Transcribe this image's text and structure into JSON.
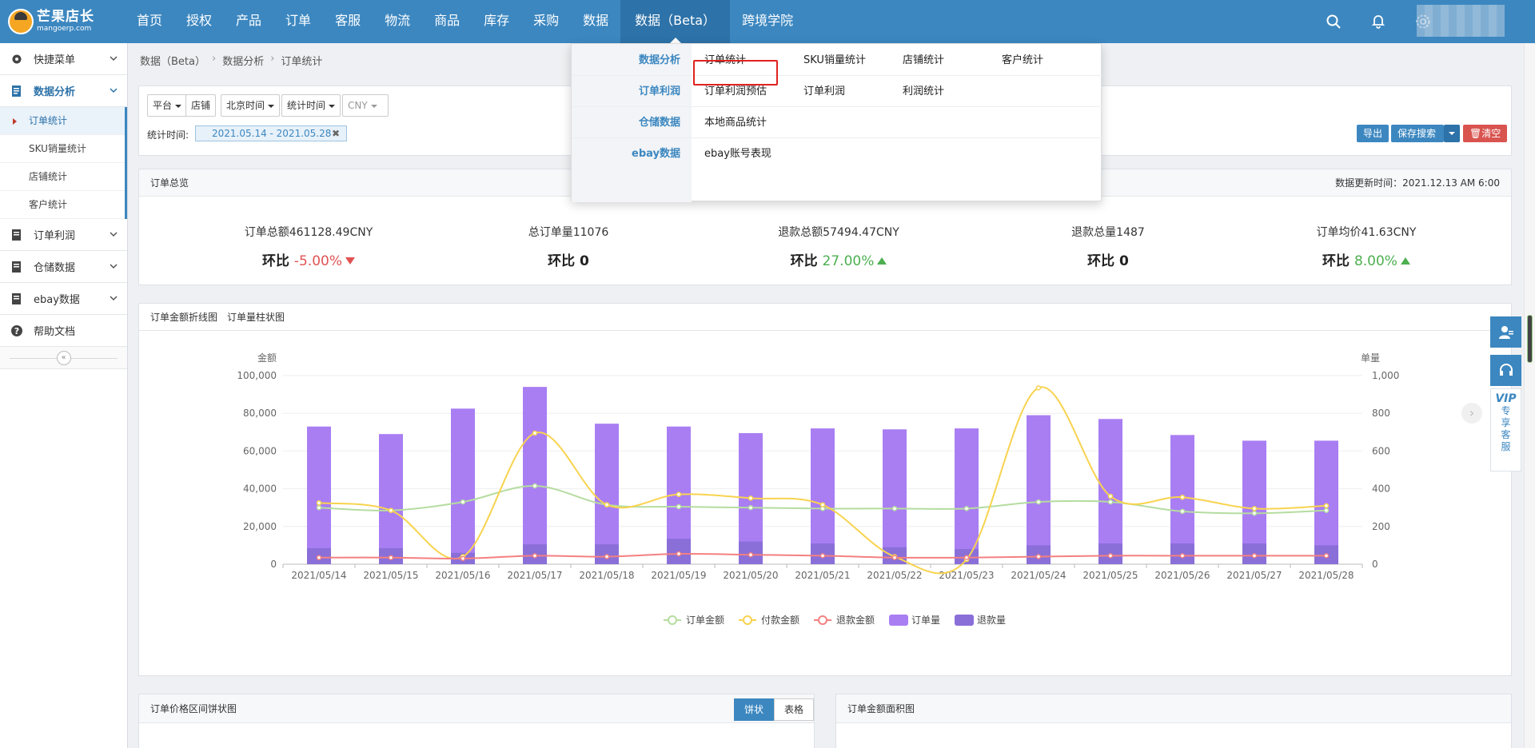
{
  "header": {
    "logo_title": "芒果店长",
    "logo_sub": "mangoerp.com",
    "nav": [
      "首页",
      "授权",
      "产品",
      "订单",
      "客服",
      "物流",
      "商品",
      "库存",
      "采购",
      "数据",
      "数据（Beta）",
      "跨境学院"
    ],
    "active_nav": "数据（Beta）",
    "icons": [
      "search-icon",
      "bell-icon",
      "gear-icon"
    ]
  },
  "sidebar": {
    "quick_menu": "快捷菜单",
    "groups": [
      {
        "label": "数据分析",
        "open": true,
        "items": [
          "订单统计",
          "SKU销量统计",
          "店铺统计",
          "客户统计"
        ]
      },
      {
        "label": "订单利润"
      },
      {
        "label": "仓储数据"
      },
      {
        "label": "ebay数据"
      },
      {
        "label": "帮助文档"
      }
    ],
    "active_item": "订单统计"
  },
  "breadcrumb": [
    "数据（Beta）",
    "数据分析",
    "订单统计"
  ],
  "filters": {
    "platform": "平台",
    "shop": "店铺",
    "timezone": "北京时间",
    "time_type": "统计时间",
    "currency": "CNY",
    "stat_time_label": "统计时间:",
    "date_range": "2021.05.14 - 2021.05.28",
    "export": "导出",
    "save_search": "保存搜索",
    "clear": "清空"
  },
  "summary": {
    "title": "订单总览",
    "updated": "数据更新时间：2021.12.13 AM 6:00",
    "kpis": [
      {
        "label": "订单总额461128.49CNY",
        "prefix": "环比",
        "value": "-5.00%",
        "trend": "down"
      },
      {
        "label": "总订单量11076",
        "prefix": "环比",
        "value": "0",
        "trend": "none"
      },
      {
        "label": "退款总额57494.47CNY",
        "prefix": "环比",
        "value": "27.00%",
        "trend": "up"
      },
      {
        "label": "退款总量1487",
        "prefix": "环比",
        "value": "0",
        "trend": "none"
      },
      {
        "label": "订单均价41.63CNY",
        "prefix": "环比",
        "value": "8.00%",
        "trend": "up"
      }
    ]
  },
  "chart_tabs": [
    "订单金额折线图",
    "订单量柱状图"
  ],
  "chart_data": {
    "type": "bar",
    "categories": [
      "2021/05/14",
      "2021/05/15",
      "2021/05/16",
      "2021/05/17",
      "2021/05/18",
      "2021/05/19",
      "2021/05/20",
      "2021/05/21",
      "2021/05/22",
      "2021/05/23",
      "2021/05/24",
      "2021/05/25",
      "2021/05/26",
      "2021/05/27",
      "2021/05/28"
    ],
    "ylabel": "金额",
    "y2label": "单量",
    "ylim": [
      0,
      100000
    ],
    "y2lim": [
      0,
      1000
    ],
    "yticks": [
      "0",
      "20,000",
      "40,000",
      "60,000",
      "80,000",
      "100,000"
    ],
    "y2ticks": [
      "0",
      "200",
      "400",
      "600",
      "800",
      "1,000"
    ],
    "series": [
      {
        "name": "订单金额",
        "kind": "line",
        "axis": "left",
        "color": "#b5dca0",
        "values": [
          30000,
          28500,
          33000,
          41500,
          31500,
          30500,
          30000,
          29500,
          29500,
          29500,
          33000,
          33000,
          28000,
          27000,
          28500
        ]
      },
      {
        "name": "付款金额",
        "kind": "line",
        "axis": "left",
        "color": "#f8d34f",
        "values": [
          32500,
          28500,
          4000,
          69500,
          31500,
          37000,
          35000,
          31500,
          4000,
          2500,
          93500,
          36000,
          35500,
          29500,
          31000
        ]
      },
      {
        "name": "退款金额",
        "kind": "line",
        "axis": "left",
        "color": "#f48080",
        "values": [
          3500,
          3500,
          3000,
          4500,
          4000,
          5500,
          5000,
          4500,
          3500,
          3500,
          4000,
          4500,
          4500,
          4500,
          4500
        ]
      },
      {
        "name": "订单量",
        "kind": "bar",
        "axis": "right",
        "color": "#a97ef3",
        "values": [
          730,
          690,
          825,
          940,
          745,
          730,
          695,
          720,
          715,
          720,
          790,
          770,
          685,
          655,
          655
        ]
      },
      {
        "name": "退款量",
        "kind": "bar",
        "axis": "right",
        "color": "#8a6fd8",
        "values": [
          85,
          85,
          60,
          105,
          105,
          135,
          120,
          110,
          90,
          80,
          100,
          110,
          110,
          110,
          100
        ]
      }
    ],
    "legend_position": "bottom"
  },
  "price_pie": {
    "title": "订单价格区间饼状图",
    "tab_pie": "饼状",
    "tab_table": "表格"
  },
  "area_chart": {
    "title": "订单金额面积图"
  },
  "dropdown": {
    "rows": [
      {
        "category": "数据分析",
        "links": [
          "订单统计",
          "SKU销量统计",
          "店铺统计",
          "客户统计"
        ]
      },
      {
        "category": "订单利润",
        "links": [
          "订单利润预估",
          "订单利润",
          "利润统计"
        ]
      },
      {
        "category": "仓储数据",
        "links": [
          "本地商品统计"
        ]
      },
      {
        "category": "ebay数据",
        "links": [
          "ebay账号表现"
        ]
      }
    ]
  },
  "float": {
    "vip_label": "VIP",
    "vip_text": [
      "专",
      "享",
      "客",
      "服"
    ]
  },
  "colors": {
    "brand": "#3c87c0",
    "danger": "#e05353",
    "success": "#4caf50"
  }
}
